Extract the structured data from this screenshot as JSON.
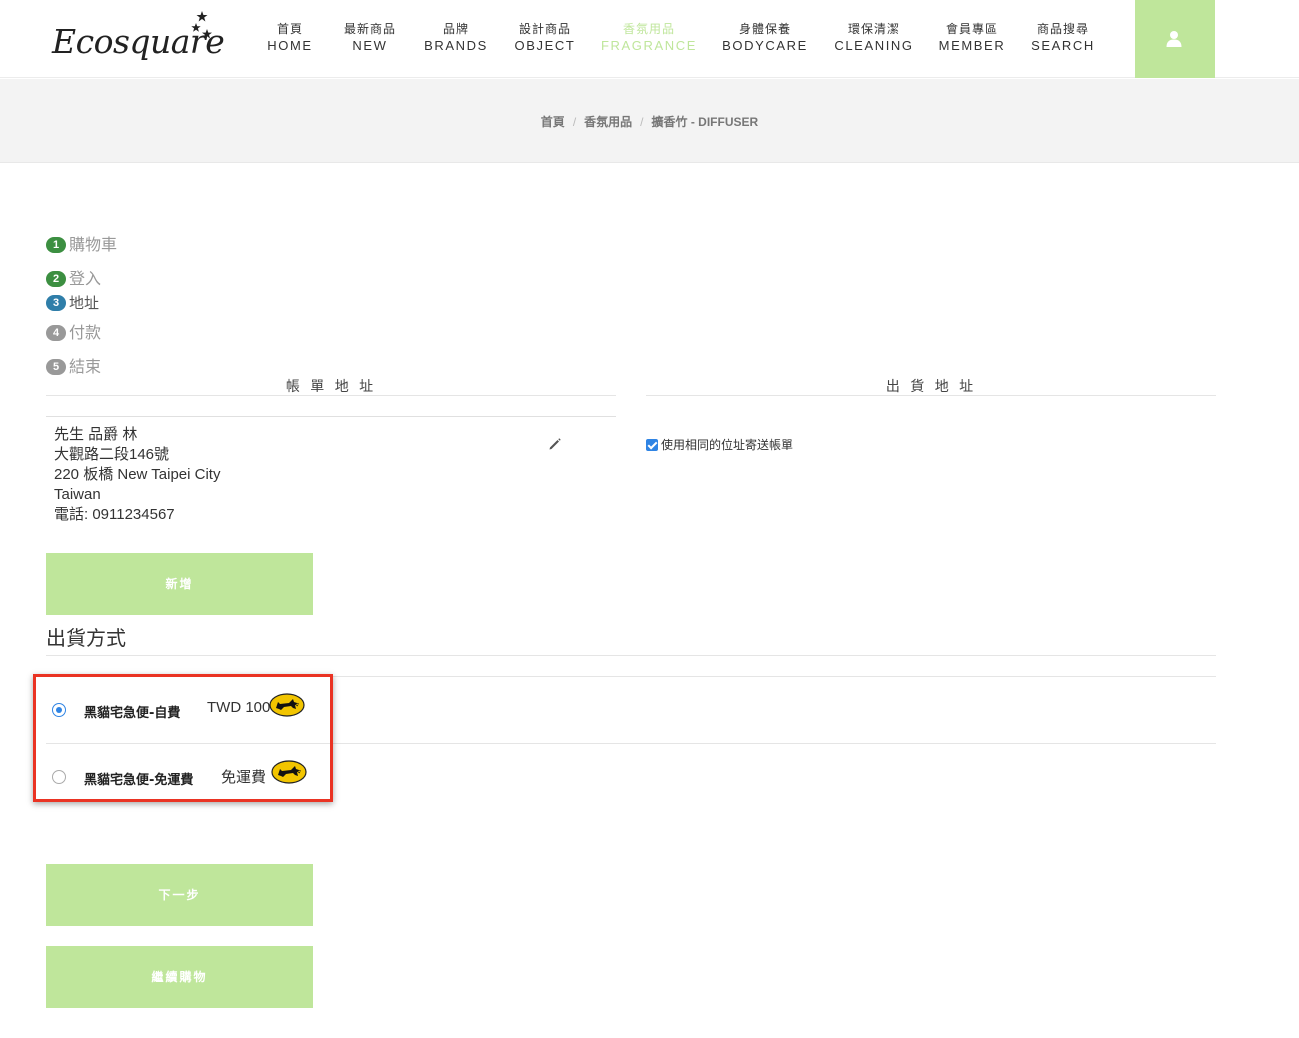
{
  "header": {
    "logo_text": "Ecosquare",
    "nav": [
      {
        "zh": "首頁",
        "en": "HOME",
        "active": false
      },
      {
        "zh": "最新商品",
        "en": "NEW",
        "active": false
      },
      {
        "zh": "品牌",
        "en": "BRANDS",
        "active": false
      },
      {
        "zh": "設計商品",
        "en": "OBJECT",
        "active": false
      },
      {
        "zh": "香氛用品",
        "en": "FRAGRANCE",
        "active": true
      },
      {
        "zh": "身體保養",
        "en": "BODYCARE",
        "active": false
      },
      {
        "zh": "環保清潔",
        "en": "CLEANING",
        "active": false
      },
      {
        "zh": "會員專區",
        "en": "MEMBER",
        "active": false
      },
      {
        "zh": "商品搜尋",
        "en": "SEARCH",
        "active": false
      }
    ],
    "account_icon": "user-icon"
  },
  "breadcrumb": [
    "首頁",
    "香氛用品",
    "擴香竹 - DIFFUSER"
  ],
  "steps": [
    {
      "num": "1",
      "label": "購物車"
    },
    {
      "num": "2",
      "label": "登入"
    },
    {
      "num": "3",
      "label": "地址"
    },
    {
      "num": "4",
      "label": "付款"
    },
    {
      "num": "5",
      "label": "結束"
    }
  ],
  "billing": {
    "heading": "帳 單 地 址",
    "lines": [
      "先生 品爵 林",
      "大觀路二段146號",
      "220 板橋 New Taipei City",
      "Taiwan",
      "電話: 0911234567"
    ],
    "edit_icon": "pencil-icon",
    "add_label": "新增"
  },
  "shipping_address": {
    "heading": "出 貨 地 址",
    "same_as_billing_label": "使用相同的位址寄送帳單",
    "same_as_billing_checked": true
  },
  "shipping_method": {
    "title": "出貨方式",
    "options": [
      {
        "name": "黑貓宅急便-自費",
        "price": "TWD 100",
        "selected": true,
        "icon": "black-cat-logo-icon"
      },
      {
        "name": "黑貓宅急便-免運費",
        "price": "免運費",
        "selected": false,
        "icon": "black-cat-logo-icon"
      }
    ]
  },
  "actions": {
    "next_label": "下一步",
    "continue_label": "繼續購物"
  },
  "colors": {
    "accent": "#bfe69b",
    "step_done": "#3c8f41",
    "step_current": "#2f7ea9",
    "step_todo": "#999999",
    "highlight": "#ea3323"
  }
}
